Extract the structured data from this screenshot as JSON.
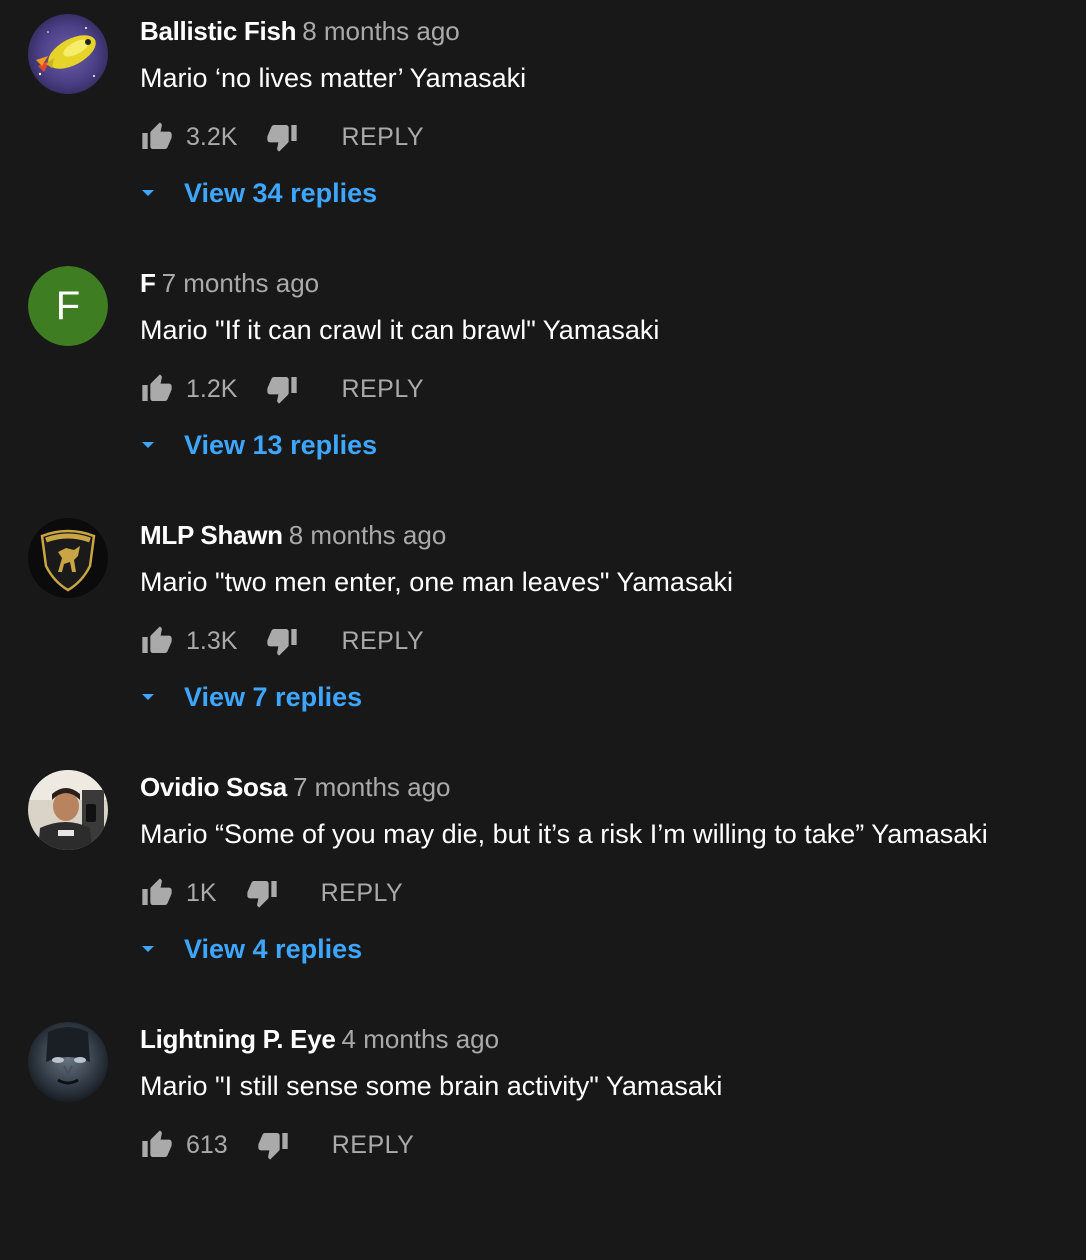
{
  "colors": {
    "background": "#181818",
    "link": "#3ea6ff",
    "muted": "#aaaaaa",
    "letter_avatar_bg": "#3e7d22"
  },
  "comments": [
    {
      "author": "Ballistic Fish",
      "time": "8 months ago",
      "text": "Mario ‘no lives matter’ Yamasaki",
      "likes": "3.2K",
      "reply_label": "REPLY",
      "view_replies": "View 34 replies",
      "avatar_icon": "fish-avatar"
    },
    {
      "author": "F",
      "time": "7 months ago",
      "text": "Mario \"If it can crawl it can brawl\" Yamasaki",
      "likes": "1.2K",
      "reply_label": "REPLY",
      "view_replies": "View 13 replies",
      "avatar_letter": "F"
    },
    {
      "author": "MLP Shawn",
      "time": "8 months ago",
      "text": "Mario \"two men enter, one man leaves\" Yamasaki",
      "likes": "1.3K",
      "reply_label": "REPLY",
      "view_replies": "View 7 replies",
      "avatar_icon": "lamborghini-shield-avatar"
    },
    {
      "author": "Ovidio Sosa",
      "time": "7 months ago",
      "text": "Mario “Some of you may die, but it’s a risk I’m willing to take” Yamasaki",
      "likes": "1K",
      "reply_label": "REPLY",
      "view_replies": "View 4 replies",
      "avatar_icon": "person-photo-avatar"
    },
    {
      "author": "Lightning P. Eye",
      "time": "4 months ago",
      "text": "Mario \"I still sense some brain activity\" Yamasaki",
      "likes": "613",
      "reply_label": "REPLY",
      "avatar_icon": "dark-face-avatar"
    }
  ]
}
